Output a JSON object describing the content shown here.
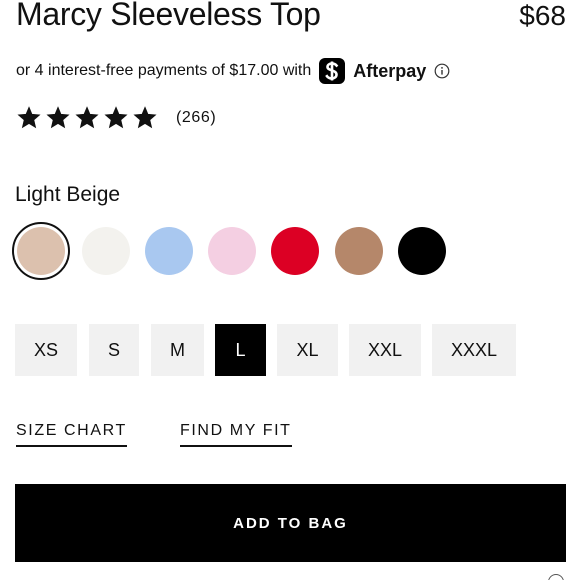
{
  "product": {
    "title": "Marcy Sleeveless Top",
    "price": "$68"
  },
  "afterpay": {
    "text": "or 4 interest-free payments of $17.00 with",
    "brand": "Afterpay",
    "logo_icon": "afterpay-logo-icon",
    "info_icon": "info-icon"
  },
  "rating": {
    "stars": 5,
    "max_stars": 5,
    "review_count": "(266)",
    "star_icon": "star-icon"
  },
  "color": {
    "selected_name": "Light Beige",
    "swatches": [
      {
        "name": "Light Beige",
        "hex": "#dcc1ae",
        "selected": true
      },
      {
        "name": "White",
        "hex": "#f3f2ee",
        "selected": false
      },
      {
        "name": "Light Blue",
        "hex": "#a9c8f0",
        "selected": false
      },
      {
        "name": "Light Pink",
        "hex": "#f4cfe2",
        "selected": false
      },
      {
        "name": "Red",
        "hex": "#dc0024",
        "selected": false
      },
      {
        "name": "Tan",
        "hex": "#b5876a",
        "selected": false
      },
      {
        "name": "Black",
        "hex": "#000000",
        "selected": false
      }
    ]
  },
  "sizes": [
    {
      "label": "XS",
      "selected": false
    },
    {
      "label": "S",
      "selected": false
    },
    {
      "label": "M",
      "selected": false
    },
    {
      "label": "L",
      "selected": true
    },
    {
      "label": "XL",
      "selected": false
    },
    {
      "label": "XXL",
      "selected": false
    },
    {
      "label": "XXXL",
      "selected": false
    }
  ],
  "links": {
    "size_chart": "SIZE CHART",
    "find_my_fit": "FIND MY FIT"
  },
  "actions": {
    "add_to_bag": "ADD TO BAG"
  },
  "colors": {
    "primary": "#000000",
    "background": "#ffffff",
    "size_button_bg": "#f1f1f1"
  }
}
